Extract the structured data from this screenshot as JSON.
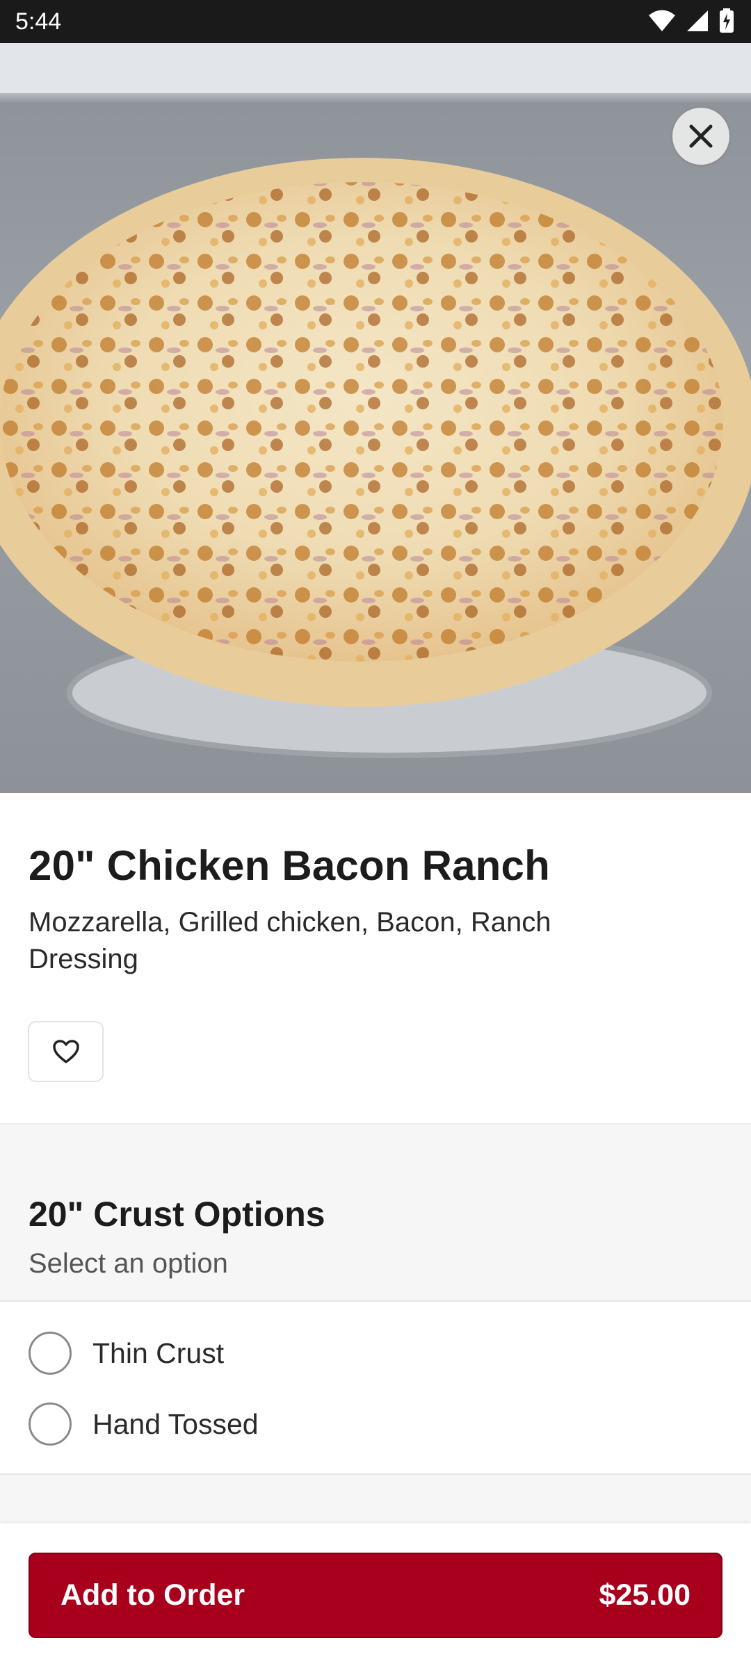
{
  "status_bar": {
    "time": "5:44",
    "icons": [
      "wifi-icon",
      "signal-icon",
      "battery-charging-icon"
    ]
  },
  "hero": {
    "image": "pizza-photo",
    "close_icon": "close-icon"
  },
  "item": {
    "title": "20\" Chicken Bacon Ranch",
    "description": "Mozzarella, Grilled chicken, Bacon, Ranch Dressing",
    "favorite_icon": "heart-icon"
  },
  "options": {
    "title": "20\" Crust Options",
    "subtitle": "Select an option",
    "choices": [
      {
        "label": "Thin Crust",
        "selected": false
      },
      {
        "label": "Hand Tossed",
        "selected": false
      }
    ]
  },
  "footer": {
    "add_label": "Add to Order",
    "price": "$25.00"
  },
  "colors": {
    "accent": "#a8001c",
    "status_bar": "#1a1a1a",
    "section_bg": "#f6f6f6"
  }
}
